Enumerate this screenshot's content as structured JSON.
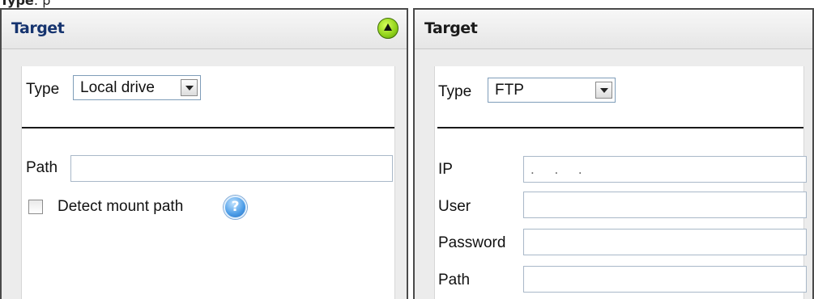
{
  "top_fragment": {
    "bold": "Type",
    "rest": ": p"
  },
  "left_panel": {
    "title": "Target",
    "type_label": "Type",
    "type_value": "Local drive",
    "path_label": "Path",
    "path_value": "",
    "detect_label": "Detect mount path",
    "help_glyph": "?",
    "icons": [
      "collapse-up-icon",
      "help-icon",
      "dropdown-arrow-icon",
      "checkbox-icon"
    ]
  },
  "right_panel": {
    "title": "Target",
    "type_label": "Type",
    "type_value": "FTP",
    "ip_label": "IP",
    "ip_placeholder": ". . .",
    "user_label": "User",
    "password_label": "Password",
    "path_label": "Path"
  }
}
